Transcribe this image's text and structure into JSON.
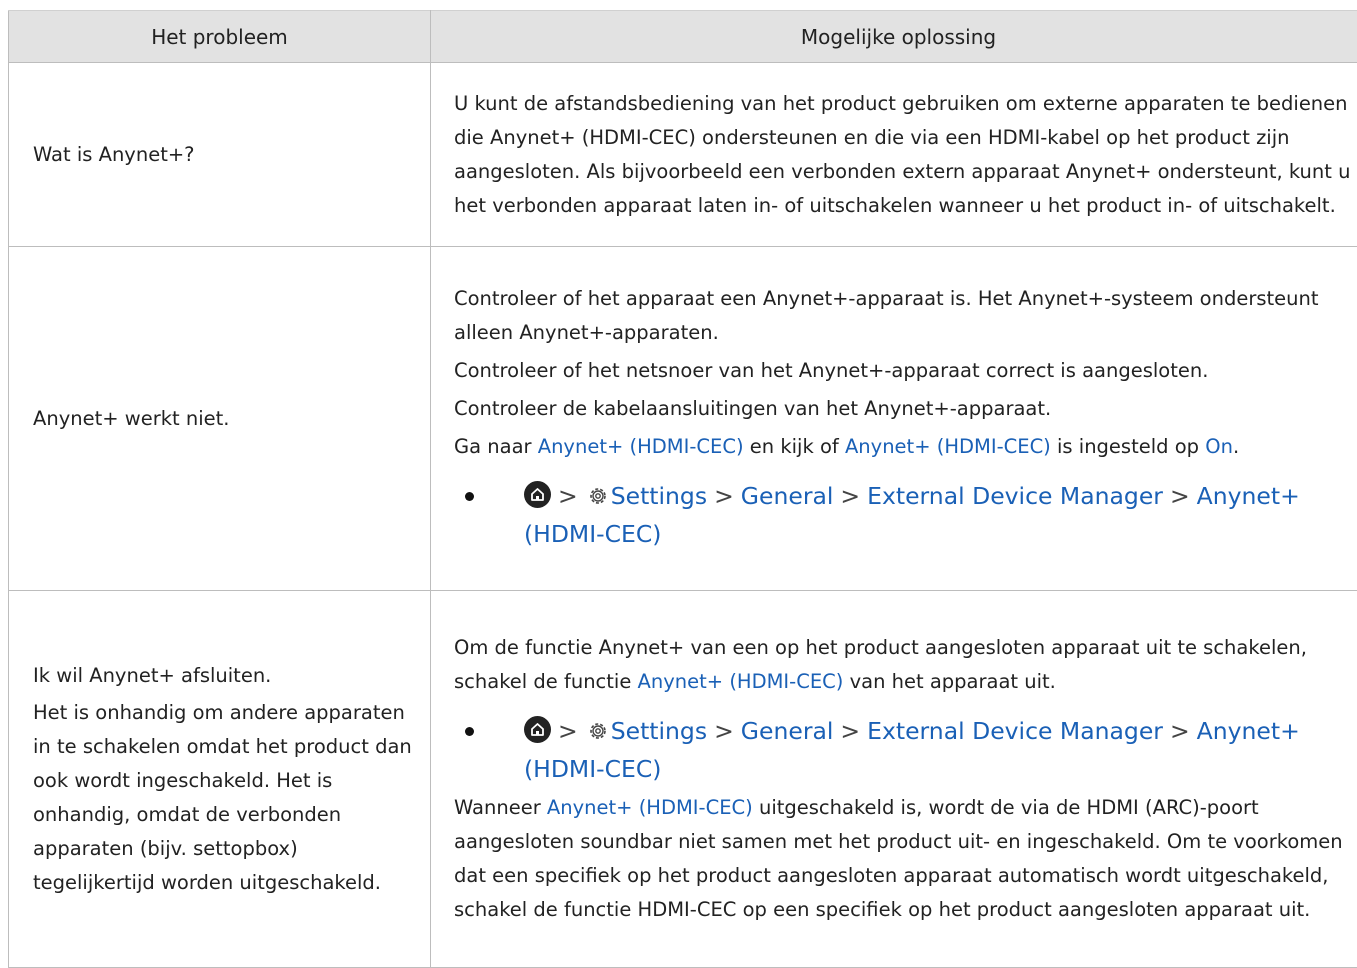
{
  "header": {
    "problem": "Het probleem",
    "solution": "Mogelijke oplossing"
  },
  "rows": [
    {
      "problem": "Wat is Anynet+?",
      "solution": "U kunt de afstandsbediening van het product gebruiken om externe apparaten te bedienen die Anynet+ (HDMI-CEC) ondersteunen en die via een HDMI-kabel op het product zijn aangesloten. Als bijvoorbeeld een verbonden extern apparaat Anynet+ ondersteunt, kunt u het verbonden apparaat laten in- of uitschakelen wanneer u het product in- of uitschakelt."
    },
    {
      "problem": "Anynet+ werkt niet.",
      "p1": "Controleer of het apparaat een Anynet+-apparaat is. Het Anynet+-systeem ondersteunt alleen Anynet+-apparaten.",
      "p2": "Controleer of het netsnoer van het Anynet+-apparaat correct is aangesloten.",
      "p3": "Controleer de kabelaansluitingen van het Anynet+-apparaat.",
      "p4": {
        "a": "Ga naar ",
        "b": "Anynet+ (HDMI-CEC)",
        "c": " en kijk of ",
        "d": "Anynet+ (HDMI-CEC)",
        "e": " is ingesteld op ",
        "f": "On",
        "g": "."
      }
    },
    {
      "problem_1": "Ik wil Anynet+ afsluiten.",
      "problem_2": "Het is onhandig om andere apparaten in te schakelen omdat het product dan ook wordt ingeschakeld. Het is onhandig, omdat de verbonden apparaten (bijv. settopbox) tegelijkertijd worden uitgeschakeld.",
      "p1": {
        "a": "Om de functie Anynet+ van een op het product aangesloten apparaat uit te schakelen, schakel de functie ",
        "b": "Anynet+ (HDMI-CEC)",
        "c": " van het apparaat uit."
      },
      "p2": {
        "a": "Wanneer ",
        "b": "Anynet+ (HDMI-CEC)",
        "c": " uitgeschakeld is, wordt de via de HDMI (ARC)-poort aangesloten soundbar niet samen met het product uit- en ingeschakeld. Om te voorkomen dat een specifiek op het product aangesloten apparaat automatisch wordt uitgeschakeld, schakel de functie HDMI-CEC op een specifiek op het product aangesloten apparaat uit."
      }
    }
  ],
  "menu_path": {
    "settings": "Settings",
    "general": "General",
    "device_manager": "External Device Manager",
    "anynet": "Anynet+ (HDMI-CEC)",
    "separator": ">",
    "icons": [
      "home-icon",
      "gear-icon"
    ]
  }
}
